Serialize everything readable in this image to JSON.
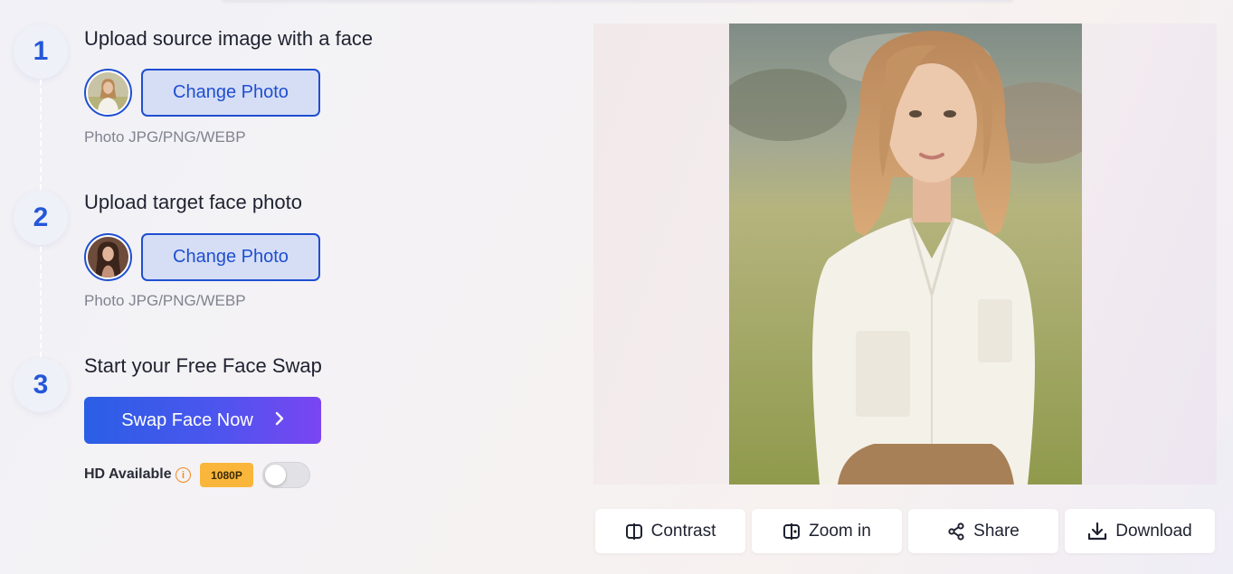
{
  "steps": [
    {
      "number": "1",
      "title": "Upload source image with a face",
      "button_label": "Change Photo",
      "hint": "Photo JPG/PNG/WEBP"
    },
    {
      "number": "2",
      "title": "Upload target face photo",
      "button_label": "Change Photo",
      "hint": "Photo JPG/PNG/WEBP"
    },
    {
      "number": "3",
      "title": "Start your Free Face Swap",
      "button_label": "Swap Face Now"
    }
  ],
  "hd": {
    "label": "HD Available",
    "badge": "1080P",
    "enabled": false
  },
  "actions": {
    "contrast": "Contrast",
    "zoom_in": "Zoom in",
    "share": "Share",
    "download": "Download"
  },
  "colors": {
    "accent": "#1f4fd0",
    "gradient_start": "#2a5fe5",
    "gradient_end": "#7a45f2",
    "badge": "#f9b63a",
    "info": "#f08a1c"
  },
  "icons": {
    "contrast": "contrast-icon",
    "zoom_in": "zoom-in-icon",
    "share": "share-icon",
    "download": "download-icon",
    "info": "info-icon",
    "chevron": "chevron-right-icon"
  }
}
